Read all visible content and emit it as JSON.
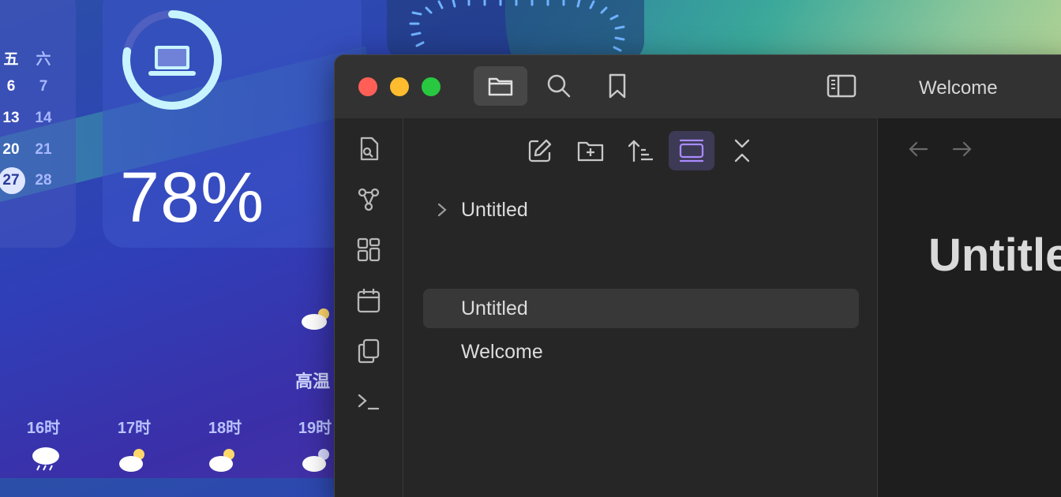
{
  "desktop": {
    "calendar": {
      "weekday_fri": "五",
      "weekday_sat": "六",
      "rows": [
        {
          "fri": "6",
          "sat": "7"
        },
        {
          "fri": "13",
          "sat": "14"
        },
        {
          "fri": "20",
          "sat": "21"
        },
        {
          "fri": "27",
          "sat": "28"
        }
      ]
    },
    "battery": {
      "percent_label": "78%",
      "level": 0.78
    },
    "weather": {
      "high_label": "高温",
      "hours": [
        "16时",
        "17时",
        "18时",
        "19时"
      ]
    }
  },
  "window": {
    "tab_title": "Welcome",
    "titlebar_buttons": [
      {
        "icon": "folder-icon",
        "active": true
      },
      {
        "icon": "search-icon",
        "active": false
      },
      {
        "icon": "bookmark-icon",
        "active": false
      }
    ],
    "ribbon": [
      "quick-switcher-icon",
      "graph-view-icon",
      "canvas-icon",
      "daily-note-icon",
      "templates-icon",
      "command-palette-icon"
    ],
    "file_explorer": {
      "nav_buttons": [
        "new-note-icon",
        "new-folder-icon",
        "sort-icon",
        "auto-reveal-icon",
        "collapse-all-icon"
      ],
      "items": [
        {
          "label": "Untitled",
          "type": "folder"
        },
        {
          "label": "Untitled",
          "type": "file",
          "selected": true
        },
        {
          "label": "Welcome",
          "type": "file"
        }
      ]
    },
    "editor": {
      "title": "Untitled"
    }
  },
  "colors": {
    "accent": "#a98bff",
    "window_bg": "#262626",
    "editor_bg": "#1e1e1e",
    "close": "#ff5f57",
    "minimize": "#febc2e",
    "maximize": "#28c840"
  }
}
